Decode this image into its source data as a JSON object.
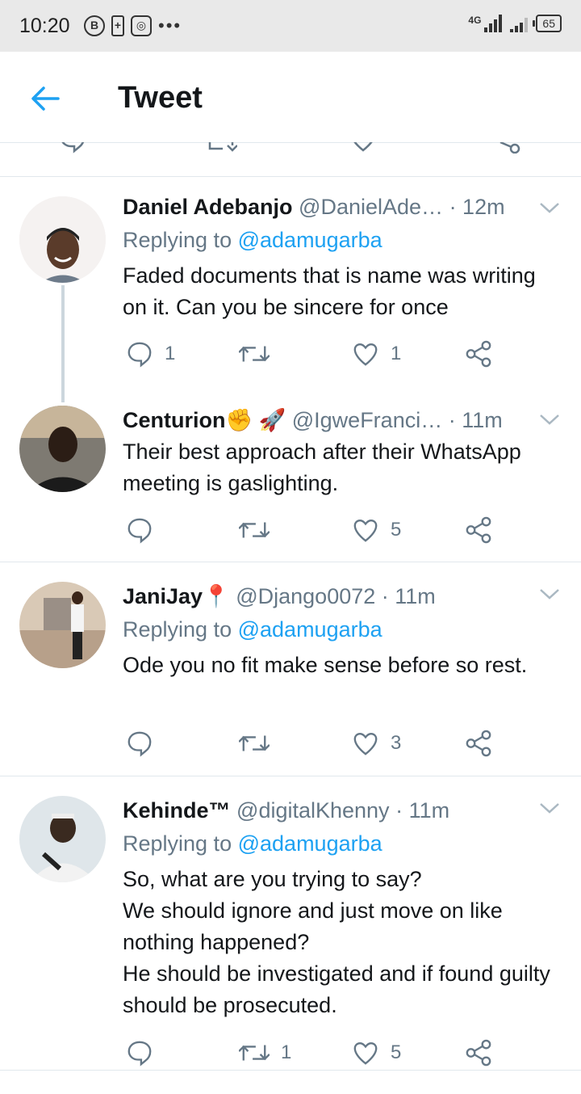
{
  "status_bar": {
    "time": "10:20",
    "network": "4G",
    "battery": "65"
  },
  "app_bar": {
    "title": "Tweet",
    "back_icon": "arrow-left-icon"
  },
  "colors": {
    "accent": "#1da1f2",
    "secondary_text": "#657786",
    "primary_text": "#14171a",
    "divider": "#e1e8ed"
  },
  "tweets": [
    {
      "name": "Daniel Adebanjo",
      "handle": "@DanielAde…",
      "time": "· 12m",
      "replying_prefix": "Replying to",
      "replying_to": "@adamugarba",
      "text": "Faded documents that is name was writing on it. Can you be sincere for once",
      "replies": "1",
      "retweets": "",
      "likes": "1"
    },
    {
      "name": "Centurion✊ 🚀",
      "handle": "@IgweFranci…",
      "time": "· 11m",
      "replying_prefix": "",
      "replying_to": "",
      "text": "Their best approach after their WhatsApp meeting is gaslighting.",
      "replies": "",
      "retweets": "",
      "likes": "5"
    },
    {
      "name": "JaniJay📍",
      "handle": "@Django0072",
      "time": "· 11m",
      "replying_prefix": "Replying to",
      "replying_to": "@adamugarba",
      "text": "Ode you no fit make sense before so rest.",
      "replies": "",
      "retweets": "",
      "likes": "3"
    },
    {
      "name": "Kehinde™",
      "handle": "@digitalKhenny",
      "time": "· 11m",
      "replying_prefix": "Replying to",
      "replying_to": "@adamugarba",
      "text_lines": [
        "So, what are you trying to say?",
        "We should ignore and just move on like nothing happened?",
        "He should be investigated and if found guilty should be prosecuted."
      ],
      "replies": "",
      "retweets": "1",
      "likes": "5"
    }
  ]
}
